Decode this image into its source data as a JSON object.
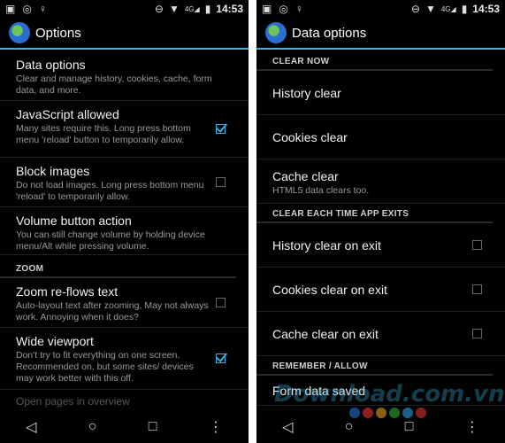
{
  "status_time": "14:53",
  "status_network": "4G",
  "left": {
    "title": "Options",
    "items": [
      {
        "title": "Data options",
        "summary": "Clear and manage history, cookies, cache, form data, and more."
      },
      {
        "title": "JavaScript allowed",
        "summary": "Many sites require this. Long press bottom menu 'reload' button to temporarily allow."
      },
      {
        "title": "Block images",
        "summary": "Do not load images. Long press bottom menu 'reload' to temporarily allow."
      },
      {
        "title": "Volume button action",
        "summary": "You can still change volume by holding device menu/Alt while pressing volume."
      }
    ],
    "section_zoom": "ZOOM",
    "zoom_items": [
      {
        "title": "Zoom re-flows text",
        "summary": "Auto-layout text after zooming. May not always work. Annoying when it does?"
      },
      {
        "title": "Wide viewport",
        "summary": "Don't try to fit everything on one screen. Recommended on, but some sites/ devices may work better with this off."
      }
    ],
    "partial": "Open pages in overview",
    "checks": {
      "javascript": true,
      "block_images": false,
      "zoom_reflow": false,
      "wide_viewport": true
    }
  },
  "right": {
    "title": "Data options",
    "section_clear_now": "CLEAR NOW",
    "history_clear": "History clear",
    "cookies_clear": "Cookies clear",
    "cache_clear": "Cache clear",
    "cache_clear_summary": "HTML5 data clears too.",
    "section_clear_exit": "CLEAR EACH TIME APP EXITS",
    "history_exit": "History clear on exit",
    "cookies_exit": "Cookies clear on exit",
    "cache_exit": "Cache clear on exit",
    "section_remember": "REMEMBER / ALLOW",
    "form_data": "Form data saved",
    "checks": {
      "history_exit": false,
      "cookies_exit": false,
      "cache_exit": false
    }
  },
  "watermark": "Download.com.vn",
  "colors": {
    "accent": "#31b6e7",
    "background": "#000000"
  }
}
